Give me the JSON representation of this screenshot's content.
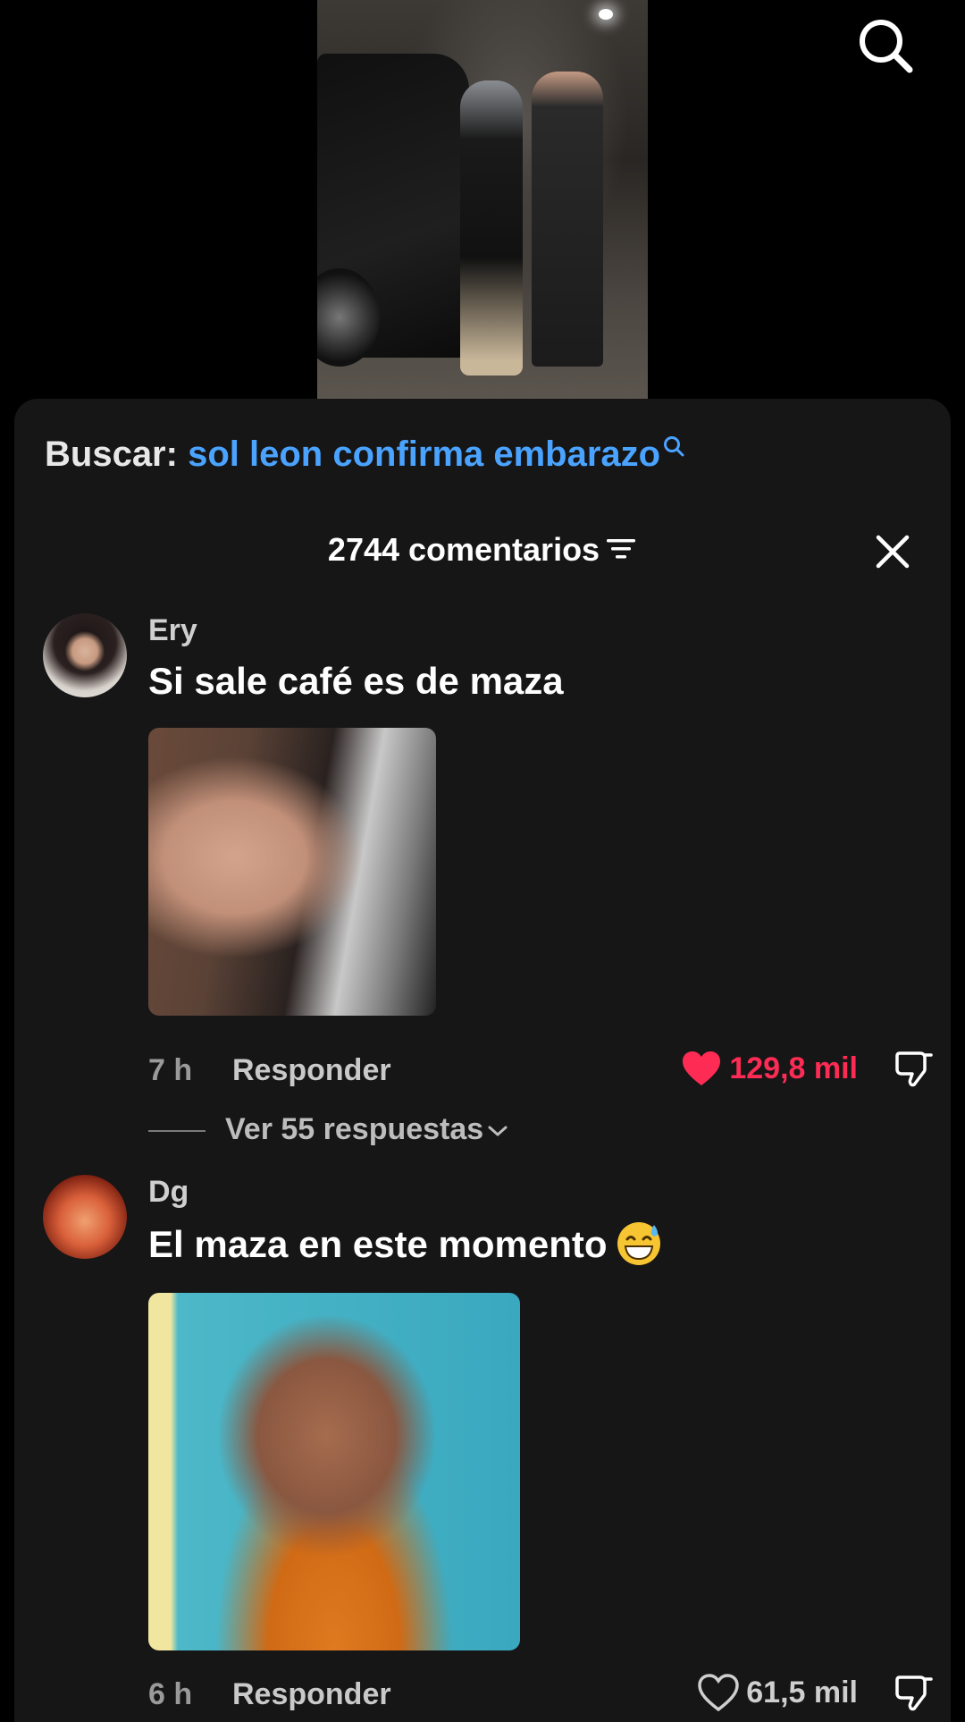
{
  "search": {
    "label": "Buscar:",
    "query": "sol leon confirma embarazo"
  },
  "header": {
    "count_label": "2744 comentarios"
  },
  "comments": [
    {
      "username": "Ery",
      "text": "Si sale café es de maza",
      "time": "7 h",
      "reply_label": "Responder",
      "likes": "129,8 mil",
      "liked": true,
      "view_replies": "Ver 55 respuestas"
    },
    {
      "username": "Dg",
      "text": "El maza en este momento",
      "time": "6 h",
      "reply_label": "Responder",
      "likes": "61,5 mil",
      "liked": false
    }
  ],
  "colors": {
    "accent_link": "#4aa3ff",
    "like_active": "#fe2c55",
    "sheet_bg": "#161616"
  },
  "icons": [
    "search-icon",
    "filter-icon",
    "close-icon",
    "heart-icon",
    "dislike-icon",
    "chevron-down-icon",
    "sweat-smile-emoji"
  ]
}
